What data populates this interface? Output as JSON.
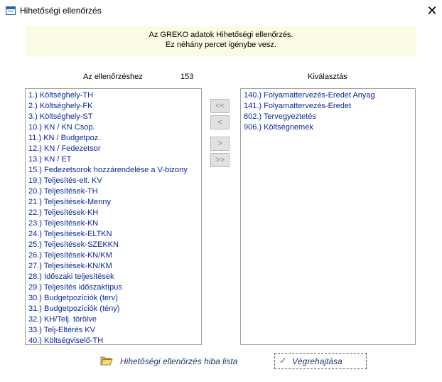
{
  "window": {
    "title": "Hihetőségi ellenőrzés",
    "close_icon": "close-icon"
  },
  "info": {
    "line1": "Az GREKO adatok Hihetőségi ellenőrzés.",
    "line2": "Ez néhány percet igénybe vesz."
  },
  "left_list": {
    "header": "Az ellenőrzéshez",
    "count": "153",
    "items": [
      "1.) Költséghely-TH",
      "2.) Költséghely-FK",
      "3.) Költséghely-ST",
      "10.) KN / KN Csop.",
      "11.) KN / Budgetpoz.",
      "12.) KN / Fedezetsor",
      "13.) KN / ET",
      "15.) Fedezetsorok hozzárendelése a V-bizony",
      "19.) Teljesítés-elt. KV",
      "20.) Teljesítések-TH",
      "21.) Teljesítések-Menny",
      "22.) Teljesítések-KH",
      "23.) Teljesítések-KN",
      "24.) Teljesítések-ELTKN",
      "25.) Teljesítések-SZEKKN",
      "26.) Teljesítések-KN/KM",
      "27.) Teljesítések-KN/KM",
      "28.) Időszaki teljesítések",
      "29.) Teljesítés időszaktípus",
      "30.) Budgetpozíciók (terv)",
      "31.) Budgetpozíciók (tény)",
      "32.) KH/Telj. törölve",
      "33.) Telj-Eltérés KV",
      "40.) Költségviselő-TH"
    ]
  },
  "right_list": {
    "header": "Kiválasztás",
    "items": [
      "140.) Folyamattervezés-Eredet Anyag",
      "141.) Folyamattervezés-Eredet",
      "802.) Tervegyeztetés",
      "906.) Költségnemek"
    ]
  },
  "move_buttons": {
    "remove_all": "<<",
    "remove_one": "<",
    "add_one": ">",
    "add_all": ">>"
  },
  "footer": {
    "error_list_label": "Hihetőségi ellenőrzés hiba lista",
    "execute_label": "Végrehajtása"
  },
  "colors": {
    "info_bg": "#fcfbe3",
    "item_text": "#0a2a9c",
    "footer_text": "#1f3b6f",
    "check": "#2f8a2f"
  }
}
